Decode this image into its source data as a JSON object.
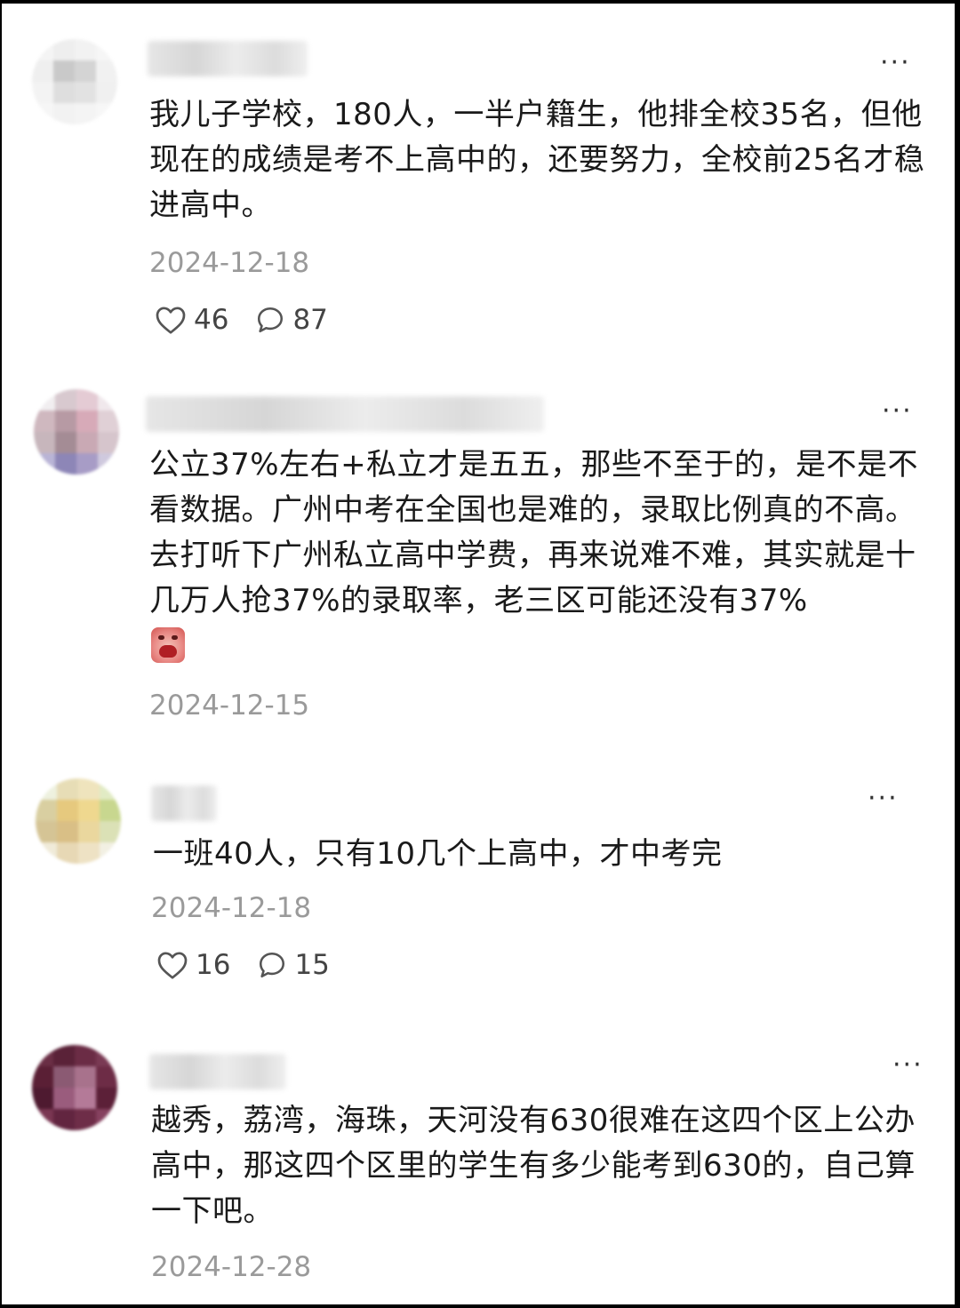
{
  "comments": [
    {
      "text": "我儿子学校，180人，一半户籍生，他排全校35名，但他现在的成绩是考不上高中的，还要努力，全校前25名才稳进高中。",
      "date": "2024-12-18",
      "likes": "46",
      "replies": "87"
    },
    {
      "text": "公立37%左右+私立才是五五，那些不至于的，是不是不看数据。广州中考在全国也是难的，录取比例真的不高。去打听下广州私立高中学费，再来说难不难，其实就是十几万人抢37%的录取率，老三区可能还没有37%",
      "emoji": "crying-face-emoji",
      "date": "2024-12-15"
    },
    {
      "text": "一班40人，只有10几个上高中，才中考完",
      "date": "2024-12-18",
      "likes": "16",
      "replies": "15"
    },
    {
      "text": "越秀，荔湾，海珠，天河没有630很难在这四个区上公办高中，那这四个区里的学生有多少能考到630的，自己算一下吧。",
      "date": "2024-12-28"
    }
  ],
  "more_glyph": "···",
  "icons": {
    "like": "heart-outline-icon",
    "reply": "speech-bubble-icon",
    "more": "more-dots-icon"
  },
  "colors": {
    "text": "#1a1a1a",
    "date": "#9a9a9a",
    "count": "#444444",
    "icon": "#555555"
  }
}
